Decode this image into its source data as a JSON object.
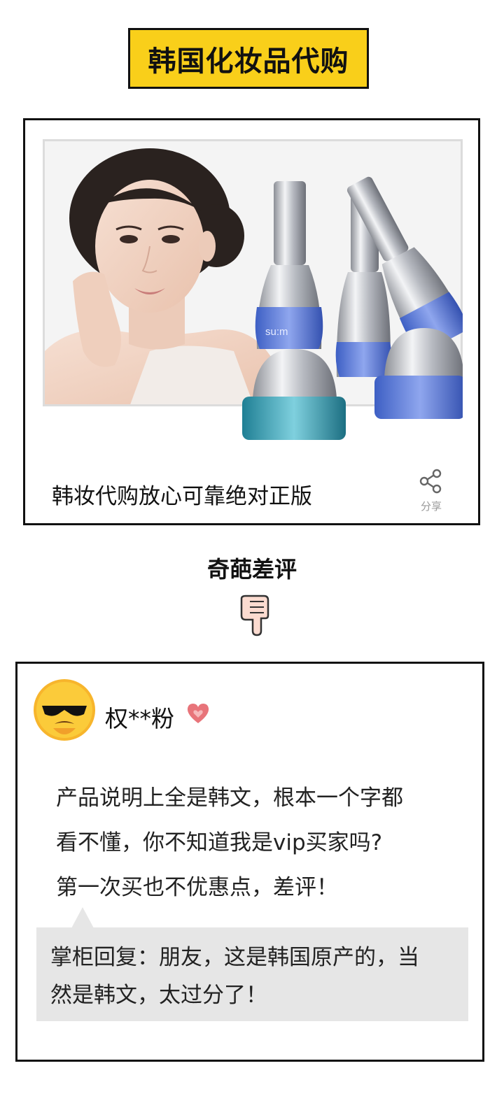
{
  "header": {
    "title": "韩国化妆品代购"
  },
  "product": {
    "bottle_brand": "su:m",
    "title": "韩妆代购放心可靠绝对正版",
    "share_label": "分享"
  },
  "section": {
    "heading": "奇葩差评"
  },
  "review": {
    "username": "权**粉",
    "body_lines": [
      "产品说明上全是韩文，根本一个字都",
      "看不懂，你不知道我是vip买家吗?",
      "第一次买也不优惠点，差评！"
    ],
    "reply_lines": [
      "掌柜回复：朋友，这是韩国原产的，当",
      "然是韩文，太过分了！"
    ]
  },
  "colors": {
    "title_bg": "#f9cf1a",
    "border": "#111111",
    "reply_bg": "#e6e6e6",
    "bottle_blue": "#4a6fd6",
    "bottle_teal": "#2a9bb0"
  }
}
